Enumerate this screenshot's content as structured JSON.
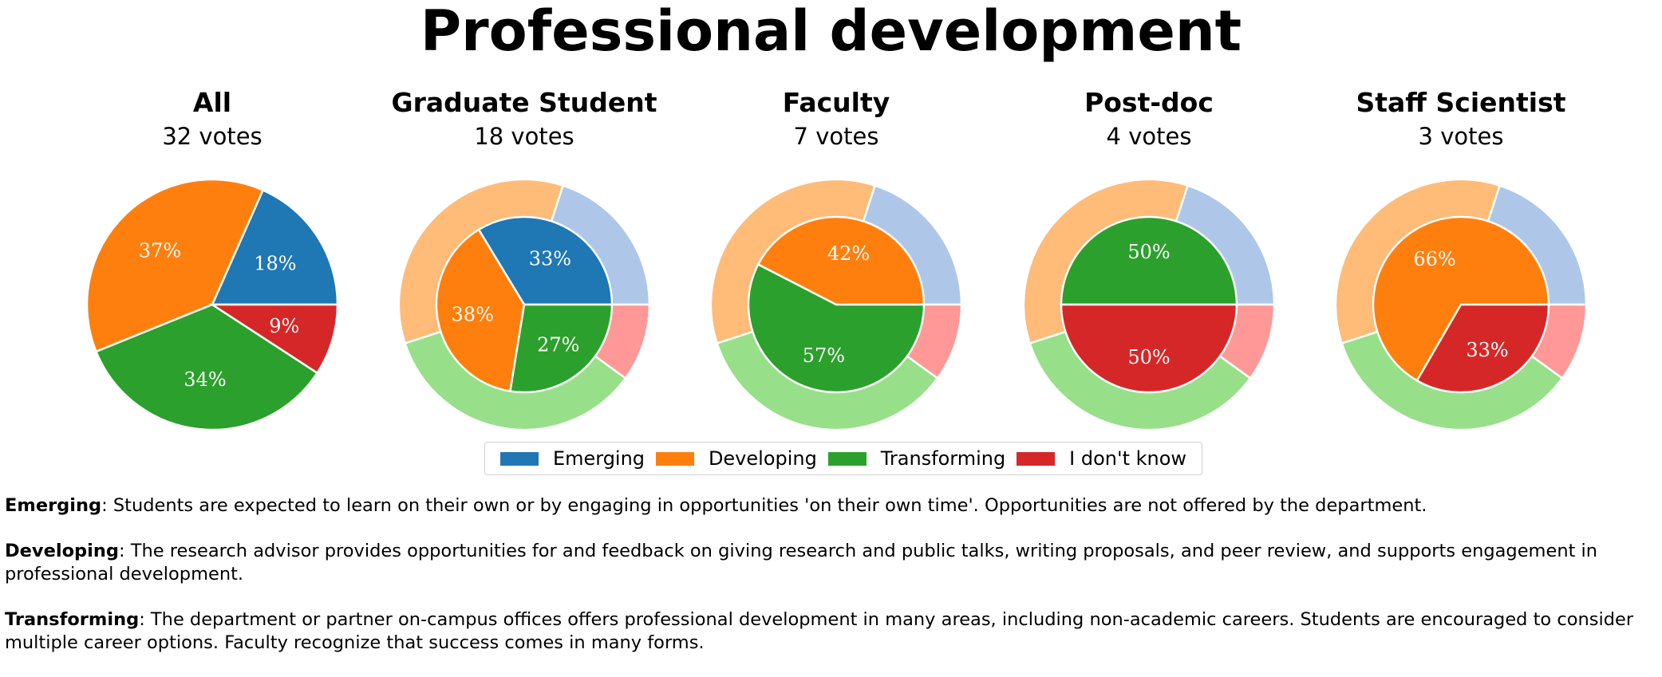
{
  "title": "Professional development",
  "chart_data": {
    "type": "pie",
    "colors": {
      "inner": [
        "#1f77b4",
        "#ff7f0e",
        "#2ca02c",
        "#d62728"
      ],
      "outer": [
        "#aec7e8",
        "#ffbb78",
        "#98df8a",
        "#ff9896"
      ]
    },
    "categories": [
      "Emerging",
      "Developing",
      "Transforming",
      "I don't know"
    ],
    "outer_ring": {
      "description_values": [
        0.2,
        0.35,
        0.35,
        0.1
      ]
    },
    "panels": [
      {
        "title": "All",
        "subtitle": "32 votes",
        "values": [
          18,
          37,
          34,
          9
        ],
        "labels": [
          "18%",
          "37%",
          "34%",
          "9%"
        ],
        "outer_ring": false
      },
      {
        "title": "Graduate Student",
        "subtitle": "18 votes",
        "values": [
          33,
          38,
          27,
          0
        ],
        "labels": [
          "33%",
          "38%",
          "27%",
          ""
        ],
        "outer_ring": true
      },
      {
        "title": "Faculty",
        "subtitle": "7 votes",
        "values": [
          0,
          42,
          57,
          0
        ],
        "labels": [
          "",
          "42%",
          "57%",
          ""
        ],
        "outer_ring": true
      },
      {
        "title": "Post-doc",
        "subtitle": "4 votes",
        "values": [
          0,
          0,
          50,
          50
        ],
        "labels": [
          "",
          "",
          "50%",
          "50%"
        ],
        "outer_ring": true
      },
      {
        "title": "Staff Scientist",
        "subtitle": "3 votes",
        "values": [
          0,
          66,
          0,
          33
        ],
        "labels": [
          "",
          "66%",
          "",
          "33%"
        ],
        "outer_ring": true
      }
    ]
  },
  "legend": [
    "Emerging",
    "Developing",
    "Transforming",
    "I don't know"
  ],
  "definitions": [
    {
      "term": "Emerging",
      "text": ": Students are expected to learn on their own or by engaging in opportunities 'on their own time'. Opportunities are not offered by the department."
    },
    {
      "term": "Developing",
      "text": ": The research advisor provides opportunities for and feedback on giving research and public talks, writing proposals, and peer review, and supports engagement in professional development."
    },
    {
      "term": "Transforming",
      "text": ": The department or partner on-campus offices offers professional development in many areas, including non-academic careers. Students are encouraged to consider multiple career options. Faculty recognize that success comes in many forms."
    }
  ]
}
